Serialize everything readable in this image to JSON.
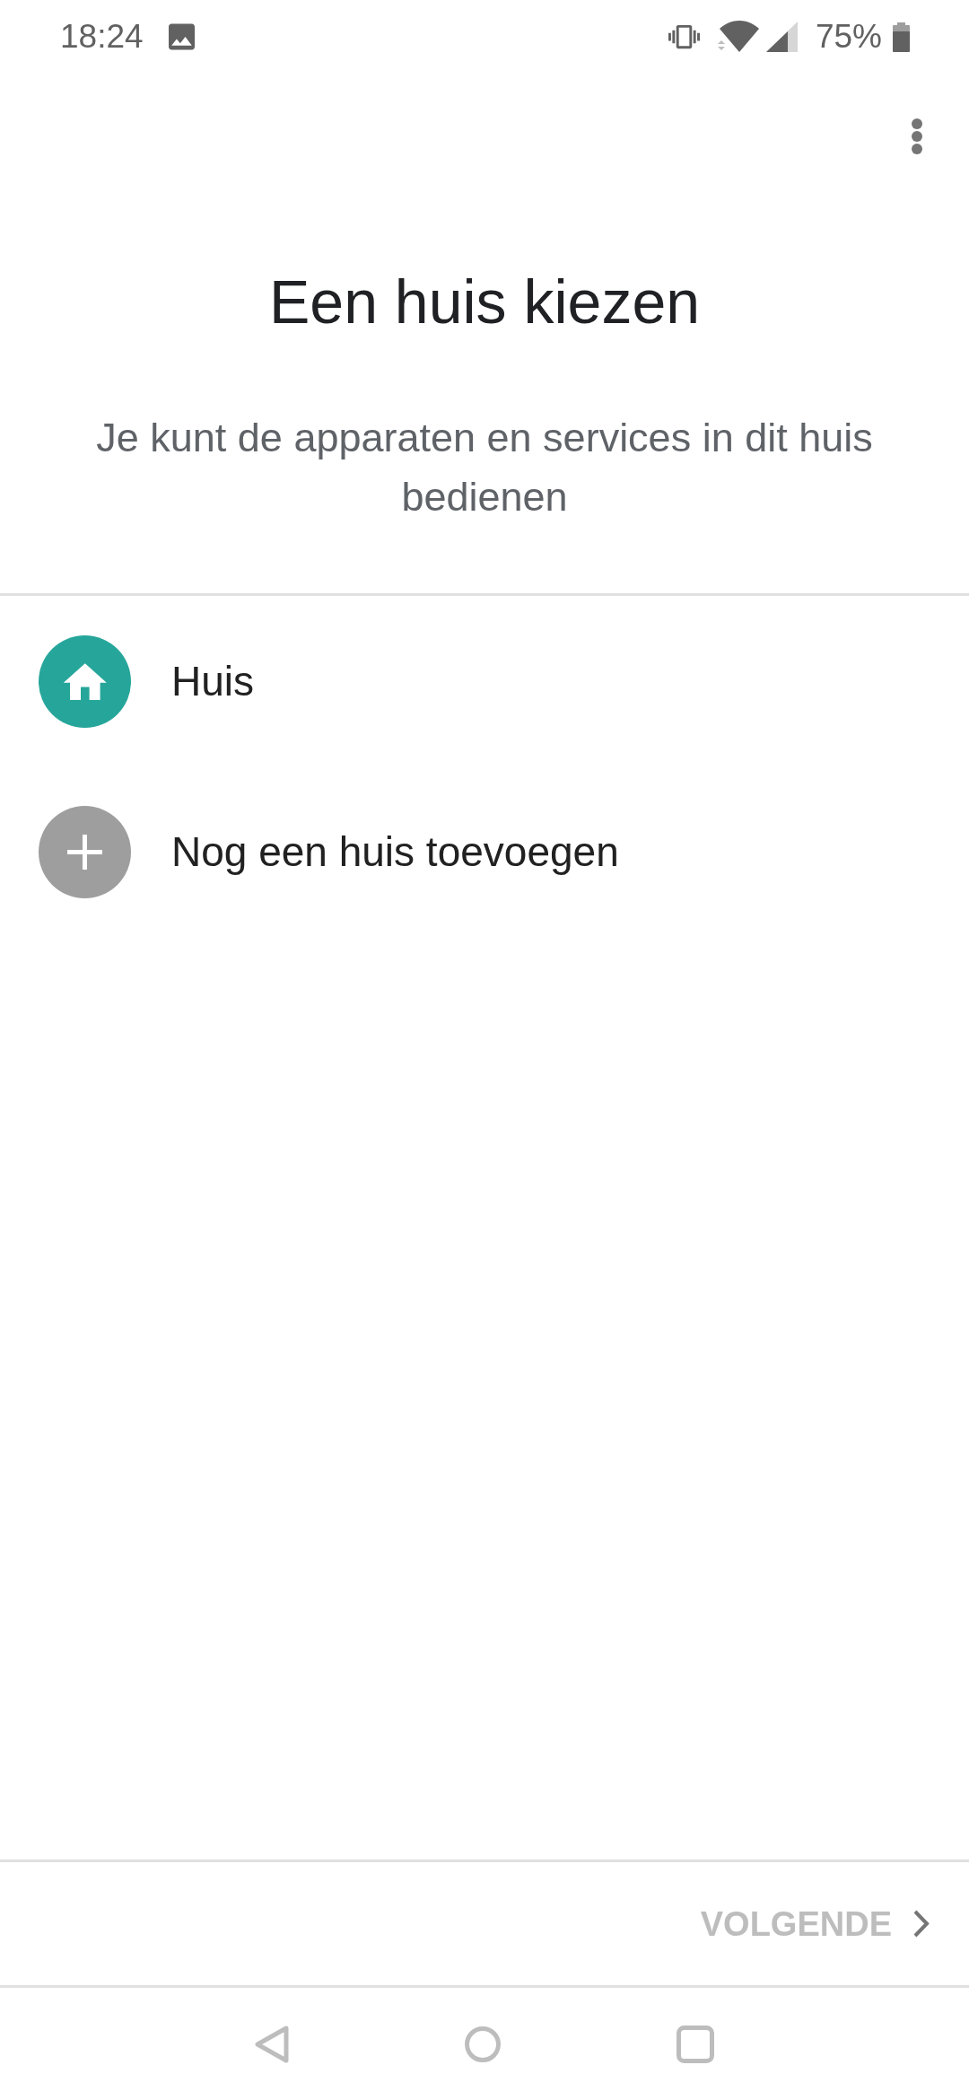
{
  "status_bar": {
    "time": "18:24",
    "battery": "75%"
  },
  "title": "Een huis kiezen",
  "subtitle": "Je kunt de apparaten en services in dit huis bedienen",
  "homes": [
    {
      "kind": "home",
      "label": "Huis"
    },
    {
      "kind": "add",
      "label": "Nog een huis toevoegen"
    }
  ],
  "footer": {
    "next_button": {
      "label": "VOLGENDE",
      "disabled": true
    }
  }
}
